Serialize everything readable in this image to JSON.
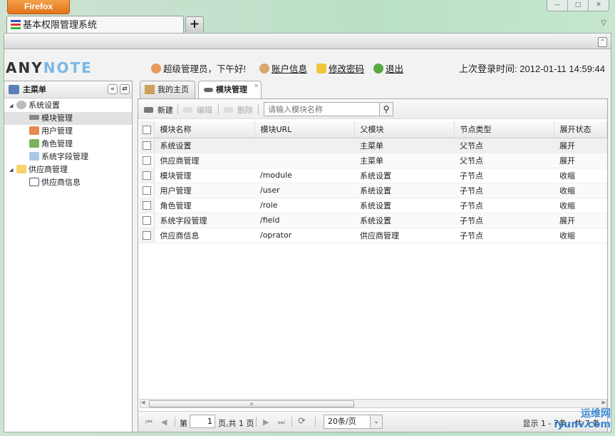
{
  "browser": {
    "menu_button": "Firefox",
    "tab_title": "基本权限管理系统",
    "new_tab": "+",
    "tab_list": "▽",
    "collapse": "⌃",
    "window_controls": [
      "—",
      "□",
      "✕"
    ]
  },
  "header": {
    "logo_part1": "ANY",
    "logo_part2": "NOTE",
    "greeting": "超级管理员，下午好!",
    "account_info": "账户信息",
    "change_password": "修改密码",
    "logout": "退出",
    "last_login_label": "上次登录时间:",
    "last_login_time": "2012-01-11 14:59:44"
  },
  "sidebar": {
    "title": "主菜单",
    "collapse_btn": "«",
    "refresh_btn": "⇄",
    "tree": [
      {
        "label": "系统设置",
        "children": [
          "模块管理",
          "用户管理",
          "角色管理",
          "系统字段管理"
        ]
      },
      {
        "label": "供应商管理",
        "children": [
          "供应商信息"
        ]
      }
    ]
  },
  "tabs": [
    {
      "label": "我的主页"
    },
    {
      "label": "模块管理",
      "close": "✕"
    }
  ],
  "toolbar": {
    "new": "新建",
    "edit": "编辑",
    "delete": "删除",
    "search_placeholder": "请输入模块名称"
  },
  "table": {
    "columns": [
      "模块名称",
      "模块URL",
      "父模块",
      "节点类型",
      "展开状态"
    ],
    "rows": [
      [
        "系统设置",
        "",
        "主菜单",
        "父节点",
        "展开"
      ],
      [
        "供应商管理",
        "",
        "主菜单",
        "父节点",
        "展开"
      ],
      [
        "模块管理",
        "/module",
        "系统设置",
        "子节点",
        "收缩"
      ],
      [
        "用户管理",
        "/user",
        "系统设置",
        "子节点",
        "收缩"
      ],
      [
        "角色管理",
        "/role",
        "系统设置",
        "子节点",
        "收缩"
      ],
      [
        "系统字段管理",
        "/field",
        "系统设置",
        "子节点",
        "展开"
      ],
      [
        "供应商信息",
        "/oprator",
        "供应商管理",
        "子节点",
        "收缩"
      ]
    ]
  },
  "pager": {
    "page_prefix": "第",
    "page": "1",
    "page_suffix": "页,共 1 页",
    "page_size": "20条/页",
    "display": "显示 1 - 7条，共 7 条"
  },
  "watermark": {
    "line1": "运维网",
    "line2": "iyunv.com"
  }
}
